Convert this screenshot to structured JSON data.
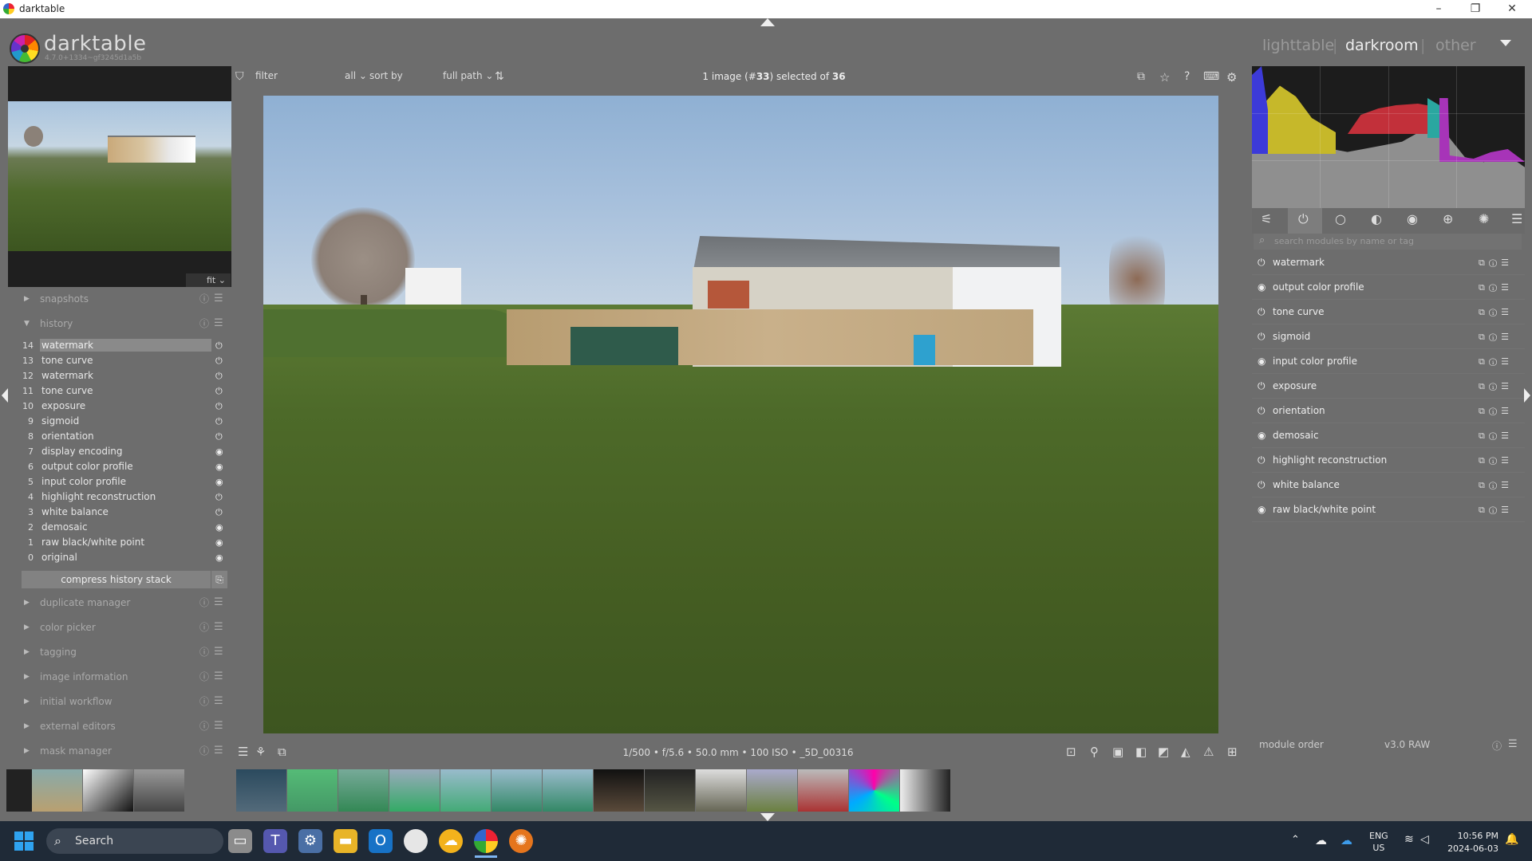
{
  "window": {
    "title": "darktable",
    "min": "–",
    "max": "❐",
    "close": "✕"
  },
  "header": {
    "brand": "darktable",
    "version": "4.7.0+1334~gf3245d1a5b",
    "views": [
      "lighttable",
      "darkroom",
      "other"
    ],
    "active_view": "darkroom",
    "separator": "|"
  },
  "left": {
    "fit_label": "fit",
    "modules_top": [
      {
        "label": "snapshots",
        "expanded": false
      },
      {
        "label": "history",
        "expanded": true
      }
    ],
    "history": [
      {
        "num": "14",
        "name": "watermark",
        "selected": true
      },
      {
        "num": "13",
        "name": "tone curve"
      },
      {
        "num": "12",
        "name": "watermark"
      },
      {
        "num": "11",
        "name": "tone curve"
      },
      {
        "num": "10",
        "name": "exposure"
      },
      {
        "num": "9",
        "name": "sigmoid"
      },
      {
        "num": "8",
        "name": "orientation"
      },
      {
        "num": "7",
        "name": "display encoding"
      },
      {
        "num": "6",
        "name": "output color profile"
      },
      {
        "num": "5",
        "name": "input color profile"
      },
      {
        "num": "4",
        "name": "highlight reconstruction"
      },
      {
        "num": "3",
        "name": "white balance"
      },
      {
        "num": "2",
        "name": "demosaic"
      },
      {
        "num": "1",
        "name": "raw black/white point"
      },
      {
        "num": "0",
        "name": "original"
      }
    ],
    "compress_label": "compress history stack",
    "modules_bottom": [
      "duplicate manager",
      "color picker",
      "tagging",
      "image information",
      "initial workflow",
      "external editors",
      "mask manager"
    ]
  },
  "toolbar": {
    "filter_label": "filter",
    "filter_value": "all",
    "sort_label": "sort by",
    "sort_value": "full path",
    "count_text_a": "1 image (#",
    "count_id": "33",
    "count_text_b": ") selected of ",
    "count_total": "36"
  },
  "bottombar": {
    "exif": "1/500 • f/5.6 • 50.0 mm • 100 ISO • _5D_00316"
  },
  "right": {
    "search_placeholder": "search modules by name or tag",
    "modules": [
      {
        "label": "watermark",
        "on": true
      },
      {
        "label": "output color profile",
        "on": false
      },
      {
        "label": "tone curve",
        "on": true
      },
      {
        "label": "sigmoid",
        "on": true
      },
      {
        "label": "input color profile",
        "on": false
      },
      {
        "label": "exposure",
        "on": true
      },
      {
        "label": "orientation",
        "on": true
      },
      {
        "label": "demosaic",
        "on": false
      },
      {
        "label": "highlight reconstruction",
        "on": true
      },
      {
        "label": "white balance",
        "on": true
      },
      {
        "label": "raw black/white point",
        "on": false
      }
    ],
    "module_order_label": "module order",
    "module_order_value": "v3.0 RAW"
  },
  "taskbar": {
    "search_label": "Search",
    "lang": "ENG",
    "region": "US",
    "time": "10:56 PM",
    "date": "2024-06-03"
  },
  "colors": {
    "accent": "#6d6d6d",
    "selected": "#8a8a8a"
  }
}
